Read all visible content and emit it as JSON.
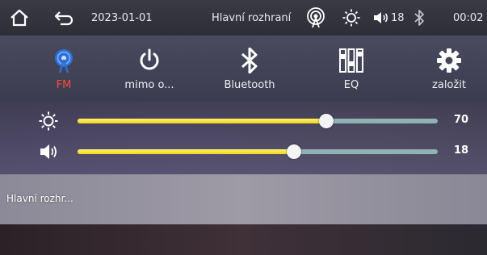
{
  "statusbar": {
    "date": "2023-01-01",
    "title": "Hlavní rozhraní",
    "volume": "18",
    "time": "00:02",
    "icons": [
      "home-icon",
      "back-icon",
      "radio-signal-icon",
      "brightness-icon",
      "volume-icon",
      "bluetooth-icon"
    ]
  },
  "apps": [
    {
      "label": "FM",
      "icon": "radio-antenna-icon",
      "active": true
    },
    {
      "label": "mimo o...",
      "icon": "power-icon",
      "active": false
    },
    {
      "label": "Bluetooth",
      "icon": "bluetooth-icon",
      "active": false
    },
    {
      "label": "EQ",
      "icon": "equalizer-icon",
      "active": false
    },
    {
      "label": "založit",
      "icon": "settings-gear-icon",
      "active": false
    }
  ],
  "sliders": {
    "brightness": {
      "value": "70",
      "level": 0.69
    },
    "volume": {
      "value": "18",
      "level": 0.6
    }
  },
  "bottom": {
    "label": "Hlavní rozhr..."
  },
  "colors": {
    "active": "#ff4a3a",
    "slider_fill": "#f5e23a",
    "slider_track": "#8fb2b2",
    "fm_icon": "#2e6fd8"
  }
}
